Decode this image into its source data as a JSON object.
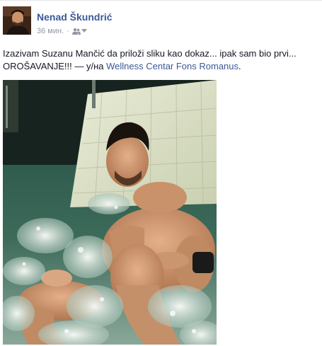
{
  "post": {
    "author": "Nenad Škundrić",
    "timestamp": "36 мин.",
    "separator": "·",
    "audience_icon": "friends-icon",
    "text_main": "Izazivam Suzanu Mančić da priloži sliku kao dokaz... ipak sam bio prvi... OROŠAVANJE!!!",
    "text_dash": " — у/на ",
    "place": "Wellness Centar Fons Romanus",
    "place_suffix": ".",
    "photo_subject": "man-in-jacuzzi-photo"
  },
  "colors": {
    "link": "#3b5998",
    "text": "#141823",
    "meta": "#9197a3"
  }
}
